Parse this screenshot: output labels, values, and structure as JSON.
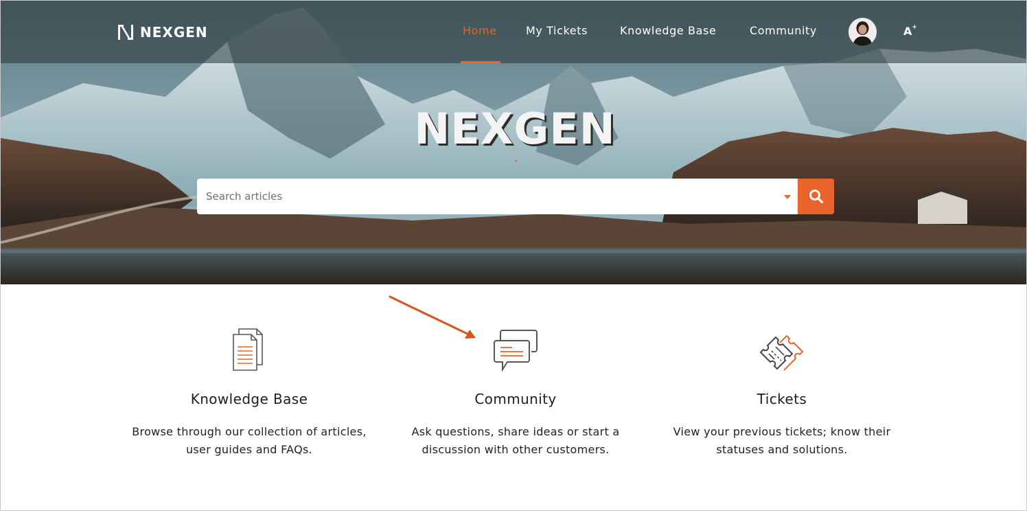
{
  "header": {
    "logo_text": "NEXGEN",
    "nav": [
      {
        "label": "Home",
        "active": true
      },
      {
        "label": "My Tickets",
        "active": false
      },
      {
        "label": "Knowledge Base",
        "active": false
      },
      {
        "label": "Community",
        "active": false
      }
    ],
    "accessibility_label": "A",
    "accent_color": "#e8642a"
  },
  "hero": {
    "title": "NEXGEN",
    "search": {
      "placeholder": "Search articles",
      "button_icon": "search-icon"
    }
  },
  "cards": [
    {
      "icon": "documents-icon",
      "title": "Knowledge Base",
      "line1": "Browse through our collection of articles,",
      "line2": "user guides and FAQs."
    },
    {
      "icon": "chat-bubbles-icon",
      "title": "Community",
      "line1": "Ask questions, share ideas or start a",
      "line2": "discussion with other customers."
    },
    {
      "icon": "ticket-icon",
      "title": "Tickets",
      "line1": "View your previous tickets; know their",
      "line2": "statuses and solutions."
    }
  ],
  "annotation": {
    "arrow_color": "#d9531e"
  }
}
